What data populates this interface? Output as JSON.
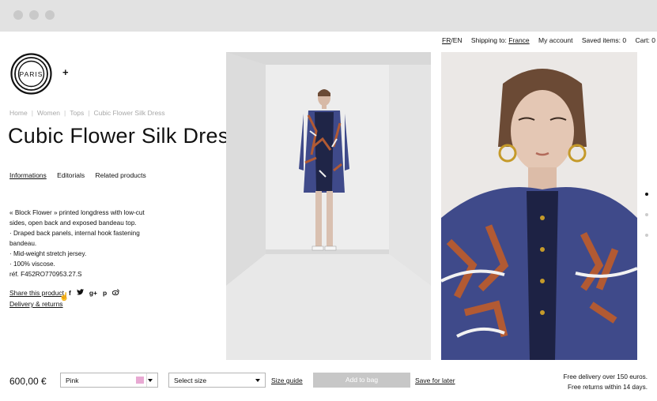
{
  "nav": {
    "lang_fr": "FR",
    "lang_sep": "/",
    "lang_en": "EN",
    "shipping_label": "Shipping to:",
    "shipping_country": "France",
    "account": "My account",
    "saved": "Saved items: 0",
    "cart": "Cart: 0"
  },
  "logo": {
    "text": "PARIS",
    "plus": "+"
  },
  "breadcrumb": [
    "Home",
    "Women",
    "Tops",
    "Cubic Flower Silk Dress"
  ],
  "breadcrumb_sep": "|",
  "product": {
    "title": "Cubic Flower Silk Dress",
    "tabs": [
      "Informations",
      "Editorials",
      "Related products"
    ],
    "description": [
      "« Block Flower » printed longdress with low-cut",
      "sides, open back and exposed bandeau top.",
      "· Draped back panels, internal hook fastening",
      "bandeau.",
      "· Mid-weight stretch jersey.",
      "· 100% viscose.",
      "réf. F452RO770953.27.S"
    ],
    "share_label": "Share this product",
    "share_icons": [
      "f",
      "t",
      "g+",
      "p",
      "w"
    ],
    "delivery_link": "Delivery & returns"
  },
  "purchase": {
    "price": "600,00 €",
    "color_value": "Pink",
    "color_swatch": "#e8a9d3",
    "size_value": "Select size",
    "size_guide": "Size guide",
    "add_to_bag": "Add to bag",
    "save_for_later": "Save for later",
    "free_delivery": "Free delivery over 150 euros.",
    "free_returns": "Free returns within 14 days."
  },
  "gallery": {
    "count": 3,
    "active": 1
  }
}
